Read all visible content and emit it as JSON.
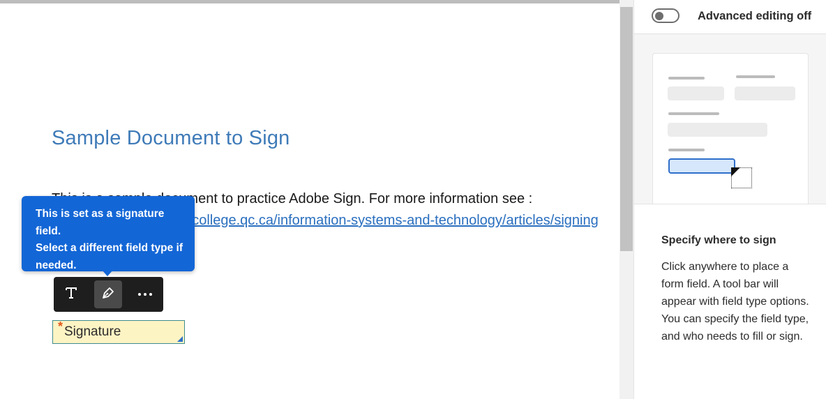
{
  "document": {
    "title": "Sample Document to Sign",
    "body_line": "This is a sample document to practice Adobe Sign. For more information see :",
    "link_text": "https://www.johnabbottcollege.qc.ca/information-systems-and-technology/articles/signing"
  },
  "tooltip": {
    "lines": [
      "This is set as a signature field.",
      "Select a different field type if",
      "needed."
    ]
  },
  "field_toolbar": {
    "text_icon": "text-icon",
    "signature_icon": "pen-icon",
    "more_icon": "more-horizontal-icon"
  },
  "signature_field": {
    "label": "Signature",
    "required_marker": "*"
  },
  "side_panel": {
    "toggle_label": "Advanced editing off",
    "toggle_on": false,
    "help_title": "Specify where to sign",
    "help_text": "Click anywhere to place a form field. A tool bar will appear with field type options. You can specify the field type, and who needs to fill or sign."
  },
  "colors": {
    "accent_blue": "#1366d6",
    "title_blue": "#3f7bb8",
    "link_blue": "#2a6fbf",
    "field_yellow": "#fdf4c4",
    "required_orange": "#e2581a",
    "toolbar_dark": "#1e1e1e"
  }
}
